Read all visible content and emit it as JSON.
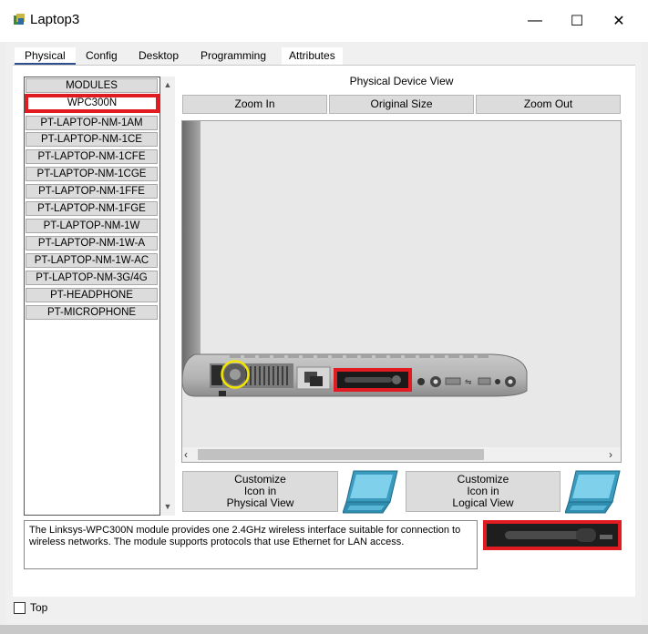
{
  "window": {
    "title": "Laptop3",
    "minimize_glyph": "—",
    "maximize_glyph": "☐",
    "close_glyph": "✕"
  },
  "tabs": [
    {
      "label": "Physical",
      "active": true
    },
    {
      "label": "Config"
    },
    {
      "label": "Desktop"
    },
    {
      "label": "Programming"
    },
    {
      "label": "Attributes"
    }
  ],
  "modules": {
    "header": "MODULES",
    "selected": "WPC300N",
    "items": [
      "WPC300N",
      "PT-LAPTOP-NM-1AM",
      "PT-LAPTOP-NM-1CE",
      "PT-LAPTOP-NM-1CFE",
      "PT-LAPTOP-NM-1CGE",
      "PT-LAPTOP-NM-1FFE",
      "PT-LAPTOP-NM-1FGE",
      "PT-LAPTOP-NM-1W",
      "PT-LAPTOP-NM-1W-A",
      "PT-LAPTOP-NM-1W-AC",
      "PT-LAPTOP-NM-3G/4G",
      "PT-HEADPHONE",
      "PT-MICROPHONE"
    ]
  },
  "device_view": {
    "title": "Physical Device View",
    "zoom_in": "Zoom In",
    "original_size": "Original Size",
    "zoom_out": "Zoom Out"
  },
  "customize": {
    "physical": [
      "Customize",
      "Icon in",
      "Physical View"
    ],
    "logical": [
      "Customize",
      "Icon in",
      "Logical View"
    ]
  },
  "description": "The Linksys-WPC300N module provides one 2.4GHz wireless interface suitable for connection to wireless networks. The module supports protocols that use Ethernet for LAN access.",
  "bottom": {
    "top_label": "Top",
    "top_checked": false
  },
  "colors": {
    "highlight_red": "#e11b22",
    "power_ring": "#f2e600",
    "tab_active_underline": "#2f4f8f",
    "laptop_icon_teal": "#3a9bbf"
  },
  "icons": [
    "app-icon",
    "laptop-icon",
    "chevron-up-icon",
    "chevron-down-icon",
    "arrow-left-icon",
    "arrow-right-icon"
  ]
}
